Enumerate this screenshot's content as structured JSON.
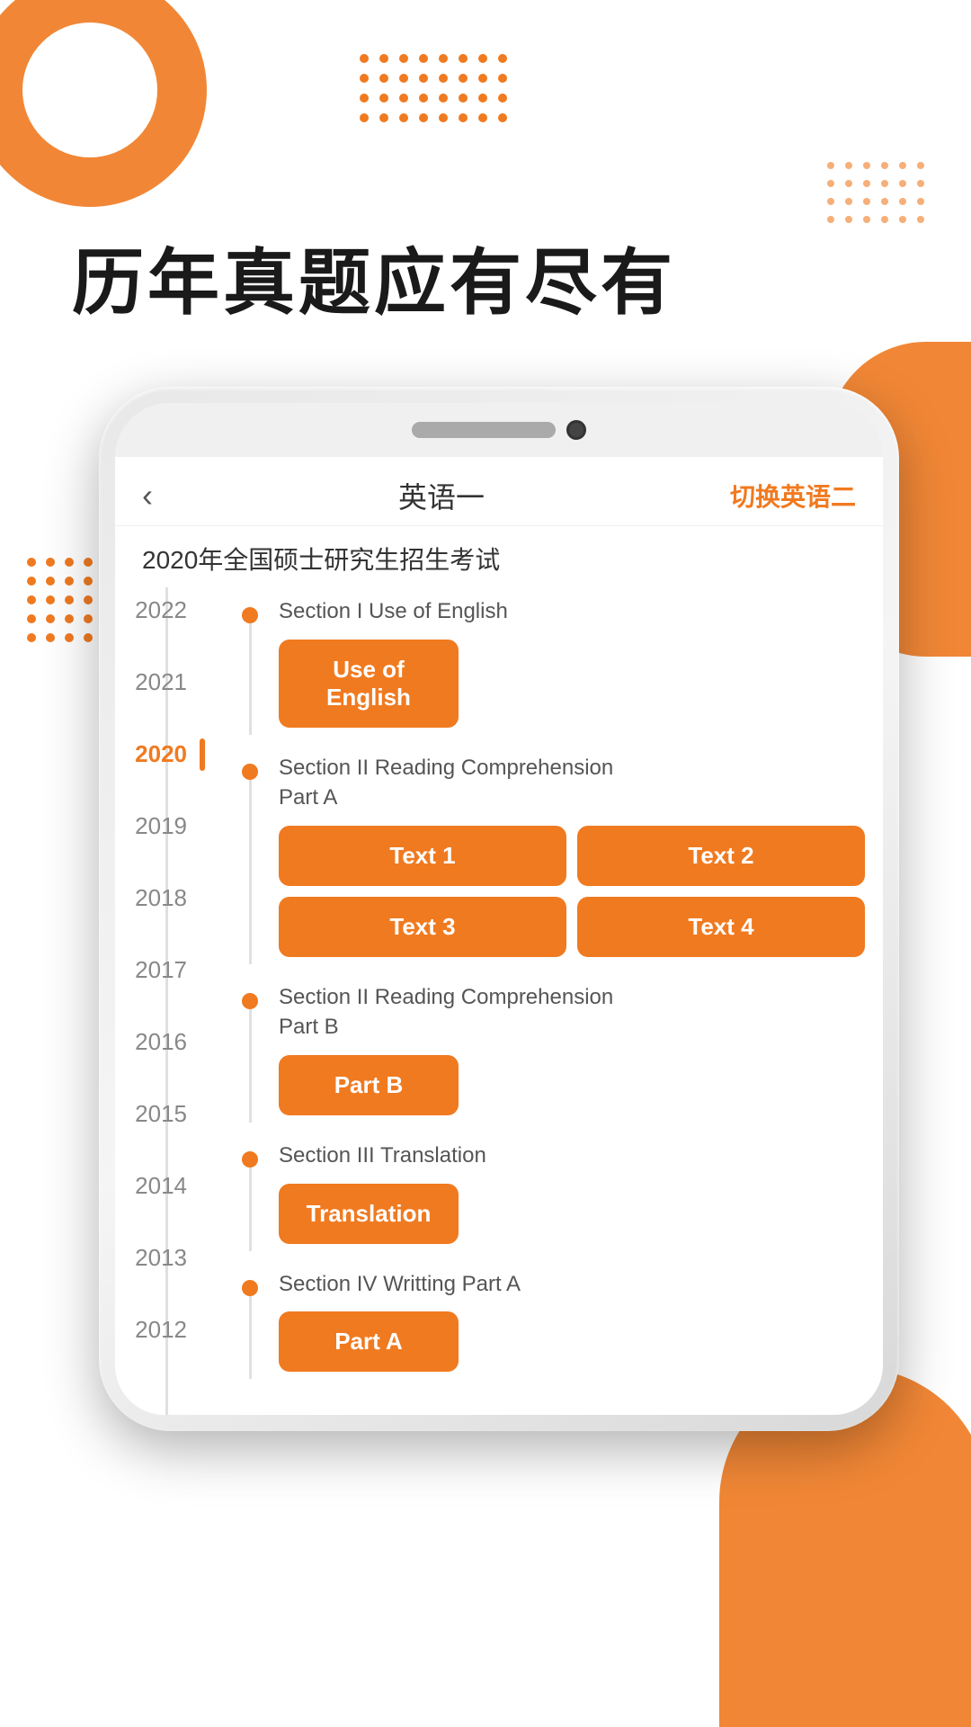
{
  "app": {
    "main_title": "历年真题应有尽有",
    "phone": {
      "header": {
        "back_label": "‹",
        "title": "英语一",
        "switch_label": "切换英语二"
      },
      "subtitle": "2020年全国硕士研究生招生考试",
      "sections": [
        {
          "id": "use-of-english",
          "label": "Section I Use of English",
          "buttons": [
            "Use of English"
          ]
        },
        {
          "id": "reading-part-a",
          "label": "Section II Reading Comprehension\nPart A",
          "buttons": [
            "Text 1",
            "Text 2",
            "Text 3",
            "Text 4"
          ]
        },
        {
          "id": "reading-part-b",
          "label": "Section II Reading Comprehension\nPart B",
          "buttons": [
            "Part B"
          ]
        },
        {
          "id": "translation",
          "label": "Section III Translation",
          "buttons": [
            "Translation"
          ]
        },
        {
          "id": "writing-part-a",
          "label": "Section IV Writting Part A",
          "buttons": [
            "Part A"
          ]
        }
      ],
      "years": [
        "2022",
        "2021",
        "2020",
        "2019",
        "2018",
        "2017",
        "2016",
        "2015",
        "2014",
        "2013",
        "2012"
      ],
      "active_year": "2020"
    }
  },
  "colors": {
    "orange": "#F07A20",
    "dark": "#1a1a1a",
    "text_gray": "#555",
    "light_gray": "#888"
  }
}
